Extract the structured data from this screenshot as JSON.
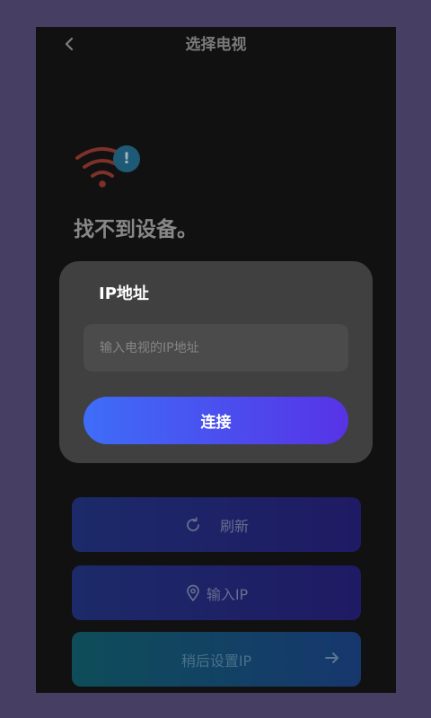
{
  "header": {
    "title": "选择电视"
  },
  "status": {
    "message": "找不到设备。"
  },
  "dialog": {
    "title": "IP地址",
    "input_placeholder": "输入电视的IP地址",
    "connect_label": "连接"
  },
  "actions": {
    "refresh_label": "刷新",
    "input_ip_label": "输入IP",
    "later_label": "稍后设置IP"
  },
  "icons": {
    "back": "chevron-left-icon",
    "wifi": "wifi-icon",
    "warning": "exclamation-icon",
    "refresh": "refresh-icon",
    "location": "location-pin-icon",
    "arrow": "arrow-right-icon"
  },
  "colors": {
    "accent_start": "#3e6df8",
    "accent_end": "#5733e6",
    "wifi_red": "#7d3129",
    "badge_blue": "#1e5a75"
  }
}
